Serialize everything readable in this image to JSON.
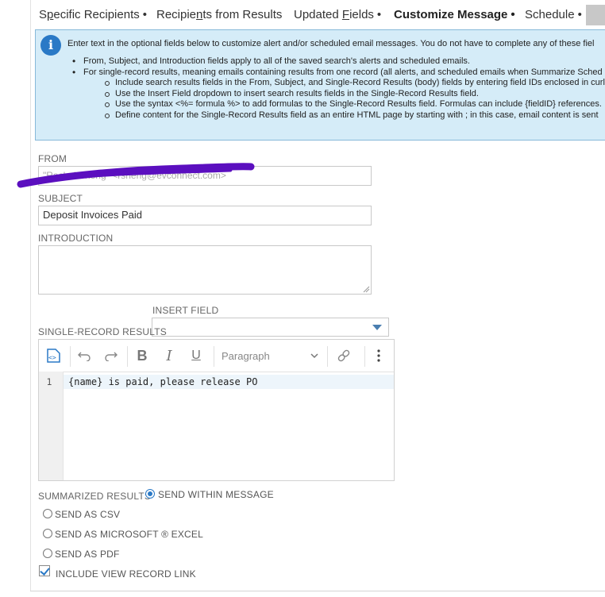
{
  "tabs": [
    {
      "pre": "S",
      "accel": "p",
      "post": "ecific Recipients",
      "dot": "•"
    },
    {
      "pre": "Recipie",
      "accel": "n",
      "post": "ts from Results",
      "dot": ""
    },
    {
      "pre": "Updated ",
      "accel": "F",
      "post": "ields",
      "dot": "•"
    },
    {
      "pre": "Customize Message",
      "accel": "",
      "post": "",
      "dot": "•"
    },
    {
      "pre": "Schedule",
      "accel": "",
      "post": "",
      "dot": "•"
    }
  ],
  "info": {
    "icon": "i",
    "intro": "Enter text in the optional fields below to customize alert and/or scheduled email messages. You do not have to complete any of these fiel",
    "bullets": [
      "From, Subject, and Introduction fields apply to all of the saved search's alerts and scheduled emails.",
      "For single-record results, meaning emails containing results from one record (all alerts, and scheduled emails when Summarize Sched"
    ],
    "sub_bullets": [
      "Include search results fields in the From, Subject, and Single-Record Results (body) fields by entering field IDs enclosed in curl",
      "Use the Insert Field dropdown to insert search results fields in the Single-Record Results field.",
      "Use the syntax <%= formula %> to add formulas to the Single-Record Results field. Formulas can include {fieldID} references.",
      "Define content for the Single-Record Results field as an entire HTML page by starting with ; in this case, email content is sent"
    ]
  },
  "form": {
    "from_label": "FROM",
    "from_value": "\"Rachel Sheng\" <rsheng@evconnect.com>",
    "subject_label": "SUBJECT",
    "subject_value": "Deposit Invoices Paid",
    "intro_label": "INTRODUCTION",
    "insert_field_label": "INSERT FIELD",
    "single_record_label": "SINGLE-RECORD RESULTS"
  },
  "editor": {
    "paragraph_label": "Paragraph",
    "line_number": "1",
    "code": "{name} is paid, please release PO"
  },
  "summarized": {
    "label": "SUMMARIZED RESULTS",
    "within": "SEND WITHIN MESSAGE",
    "csv": "SEND AS CSV",
    "excel": "SEND AS MICROSOFT ® EXCEL",
    "pdf": "SEND AS PDF",
    "view_link": "INCLUDE VIEW RECORD LINK"
  },
  "colors": {
    "accent": "#2a79c6",
    "info_bg": "#d5ecf8",
    "redaction": "#5b0fbf"
  }
}
